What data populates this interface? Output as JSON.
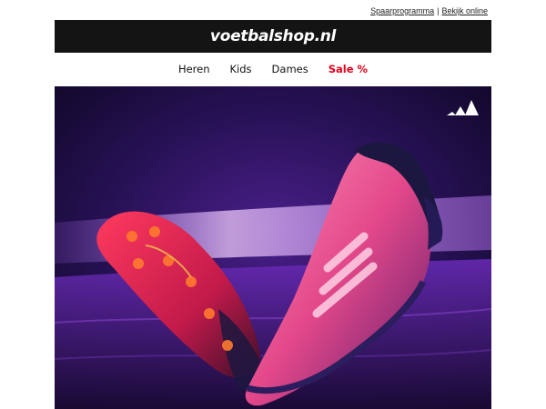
{
  "top_links": {
    "spaarprogramma": "Spaarprogramma",
    "separator": "|",
    "bekijk_online": "Bekijk online"
  },
  "brand": {
    "name": "voetbalshop.nl"
  },
  "nav": {
    "items": [
      {
        "label": "Heren"
      },
      {
        "label": "Kids"
      },
      {
        "label": "Dames"
      },
      {
        "label": "Sale %"
      }
    ]
  },
  "hero": {
    "brand_logo_icon": "adidas-logo-icon",
    "subject": "football-boots-image"
  },
  "colors": {
    "brand_bar": "#141414",
    "sale": "#e3001b",
    "hero_bg": "#1a0d3a",
    "boot_pink": "#e8568f",
    "boot_dark": "#1c1740"
  }
}
